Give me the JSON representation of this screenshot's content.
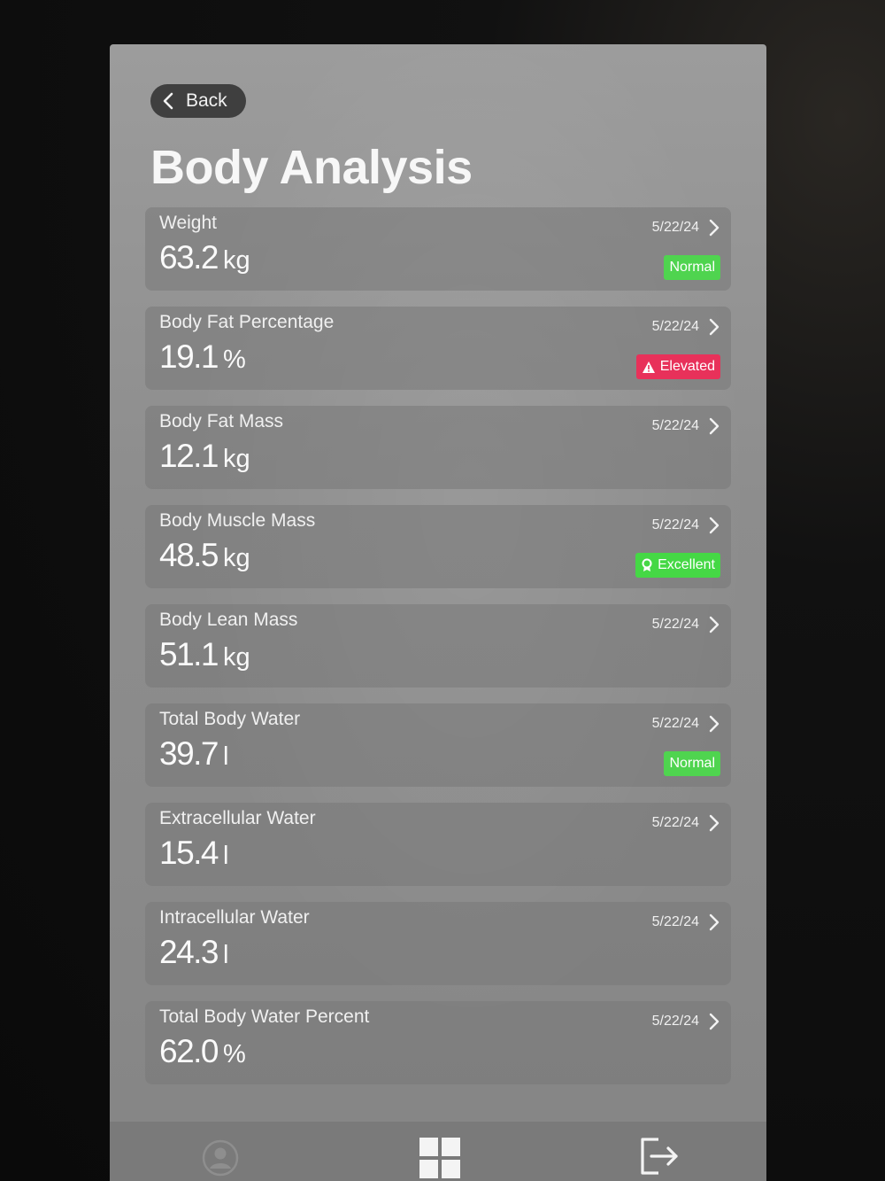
{
  "header": {
    "back_label": "Back",
    "title": "Body Analysis"
  },
  "colors": {
    "normal": "#4fd44f",
    "elevated": "#e8315a",
    "excellent": "#45d845"
  },
  "metrics": [
    {
      "label": "Weight",
      "value": "63.2",
      "unit": "kg",
      "date": "5/22/24",
      "badge": "Normal",
      "badge_type": "normal"
    },
    {
      "label": "Body Fat Percentage",
      "value": "19.1",
      "unit": "%",
      "date": "5/22/24",
      "badge": "Elevated",
      "badge_type": "elevated"
    },
    {
      "label": "Body Fat Mass",
      "value": "12.1",
      "unit": "kg",
      "date": "5/22/24",
      "badge": "",
      "badge_type": ""
    },
    {
      "label": "Body Muscle Mass",
      "value": "48.5",
      "unit": "kg",
      "date": "5/22/24",
      "badge": "Excellent",
      "badge_type": "excellent"
    },
    {
      "label": "Body Lean Mass",
      "value": "51.1",
      "unit": "kg",
      "date": "5/22/24",
      "badge": "",
      "badge_type": ""
    },
    {
      "label": "Total Body Water",
      "value": "39.7",
      "unit": "l",
      "date": "5/22/24",
      "badge": "Normal",
      "badge_type": "normal"
    },
    {
      "label": "Extracellular Water",
      "value": "15.4",
      "unit": "l",
      "date": "5/22/24",
      "badge": "",
      "badge_type": ""
    },
    {
      "label": "Intracellular Water",
      "value": "24.3",
      "unit": "l",
      "date": "5/22/24",
      "badge": "",
      "badge_type": ""
    },
    {
      "label": "Total Body Water Percent",
      "value": "62.0",
      "unit": "%",
      "date": "5/22/24",
      "badge": "",
      "badge_type": ""
    }
  ],
  "bottom_nav": {
    "items": [
      "profile-icon",
      "grid-icon",
      "logout-icon"
    ]
  }
}
